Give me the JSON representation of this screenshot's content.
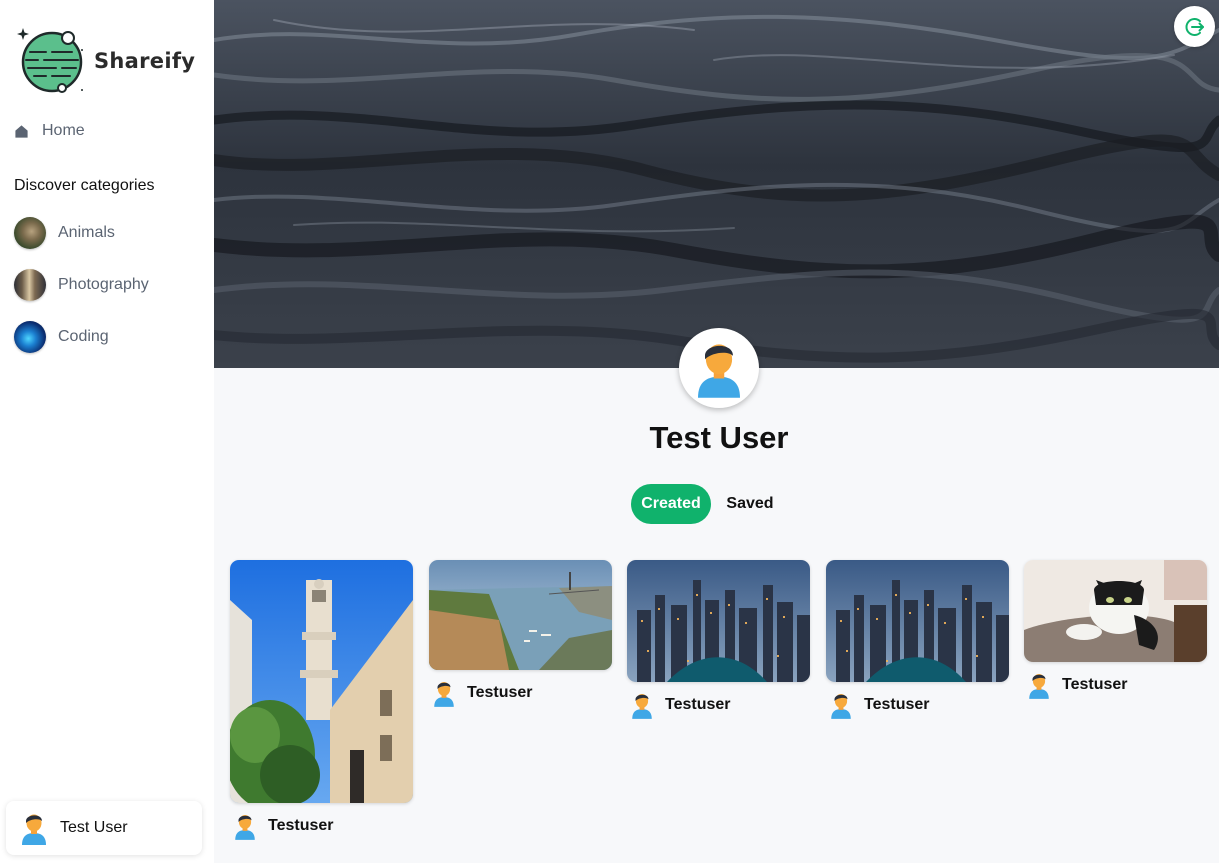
{
  "app": {
    "name": "Shareify"
  },
  "sidebar": {
    "home_label": "Home",
    "categories_title": "Discover categories",
    "categories": [
      {
        "label": "Animals"
      },
      {
        "label": "Photography"
      },
      {
        "label": "Coding"
      }
    ],
    "current_user": "Test User"
  },
  "profile": {
    "name": "Test User",
    "tabs": {
      "created": "Created",
      "saved": "Saved"
    },
    "active_tab": "Created"
  },
  "pins": [
    {
      "author": "Testuser",
      "image": "tower-building"
    },
    {
      "author": "Testuser",
      "image": "harbor-city"
    },
    {
      "author": "Testuser",
      "image": "night-skyline"
    },
    {
      "author": "Testuser",
      "image": "night-skyline"
    },
    {
      "author": "Testuser",
      "image": "cat"
    }
  ],
  "icons": {
    "home": "home-icon",
    "logout": "logout-icon",
    "avatar": "user-avatar-icon"
  },
  "colors": {
    "accent": "#10b26c",
    "sidebar_text": "#5b6472",
    "background": "#f7f8fa"
  }
}
